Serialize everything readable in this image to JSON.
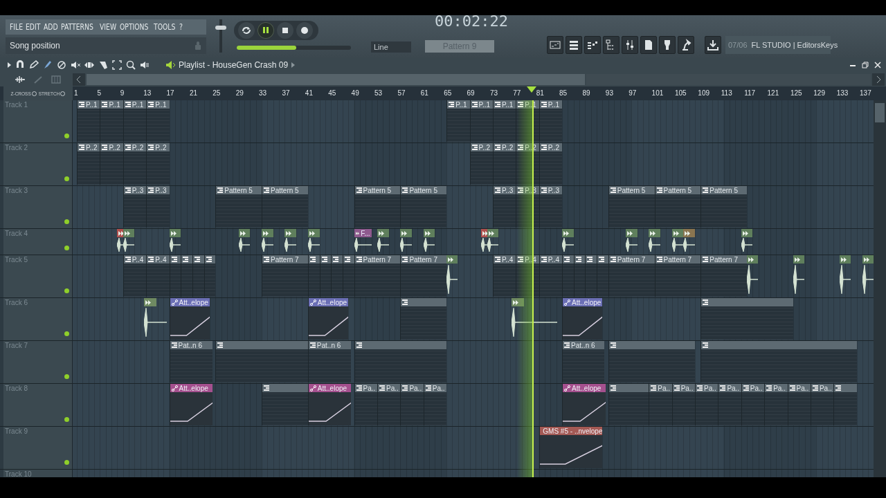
{
  "menu": [
    "FILE",
    "EDIT",
    "ADD",
    "PATTERNS",
    "VIEW",
    "OPTIONS",
    "TOOLS",
    "?"
  ],
  "song_position": {
    "placeholder": "Song position"
  },
  "sliders": [
    {
      "kind": "vertical",
      "level": 0.78
    },
    {
      "kind": "horizontal",
      "level": 0.52
    }
  ],
  "transport": {
    "time": "00:02:22",
    "buttons": [
      {
        "kind": "loop",
        "on": false
      },
      {
        "kind": "pause",
        "on": true
      },
      {
        "kind": "stop",
        "on": false
      },
      {
        "kind": "record",
        "on": false
      }
    ],
    "snap": "Line",
    "pattern": "Pattern 9"
  },
  "hint": {
    "counter": "07/06",
    "text": "FL STUDIO | EditorsKeys"
  },
  "playlist": {
    "title": "Playlist - HouseGen Crash 09",
    "toggles": [
      {
        "label": "Z-CROSS",
        "on": false
      },
      {
        "label": "STRETCH",
        "on": false
      }
    ],
    "ruler": [
      "1",
      "5",
      "9",
      "13",
      "17",
      "21",
      "25",
      "29",
      "33",
      "37",
      "41",
      "45",
      "49",
      "53",
      "57",
      "61",
      "65",
      "69",
      "73",
      "77",
      "81",
      "85",
      "89",
      "93",
      "97",
      "101",
      "105",
      "109",
      "113",
      "117",
      "121",
      "125",
      "129",
      "133",
      "137"
    ],
    "tracks": [
      {
        "name": "Track 1",
        "muted": false,
        "clips": [
          {
            "kind": "pattern",
            "label": "P..1"
          },
          {
            "kind": "pattern",
            "label": "P..1"
          },
          {
            "kind": "pattern",
            "label": "P..1"
          },
          {
            "kind": "pattern",
            "label": "P..1"
          },
          {
            "kind": "pattern",
            "label": "P..1"
          },
          {
            "kind": "pattern",
            "label": "P..1"
          },
          {
            "kind": "pattern",
            "label": "P..1"
          },
          {
            "kind": "pattern",
            "label": "P..1"
          },
          {
            "kind": "pattern",
            "label": "P..1"
          }
        ]
      },
      {
        "name": "Track 2",
        "muted": false,
        "clips": [
          {
            "kind": "pattern",
            "label": "P..2"
          },
          {
            "kind": "pattern",
            "label": "P..2"
          },
          {
            "kind": "pattern",
            "label": "P..2"
          },
          {
            "kind": "pattern",
            "label": "P..2"
          },
          {
            "kind": "pattern",
            "label": "P..2"
          },
          {
            "kind": "pattern",
            "label": "P..2"
          },
          {
            "kind": "pattern",
            "label": "P..2"
          },
          {
            "kind": "pattern",
            "label": "P..2"
          }
        ]
      },
      {
        "name": "Track 3",
        "muted": false,
        "clips": [
          {
            "kind": "pattern",
            "label": "P..3"
          },
          {
            "kind": "pattern",
            "label": "P..3"
          },
          {
            "kind": "pattern",
            "label": "Pattern 5"
          },
          {
            "kind": "pattern",
            "label": "Pattern 5"
          },
          {
            "kind": "pattern",
            "label": "Pattern 5"
          },
          {
            "kind": "pattern",
            "label": "Pattern 5"
          },
          {
            "kind": "pattern",
            "label": "P..3"
          },
          {
            "kind": "pattern",
            "label": "P..3"
          },
          {
            "kind": "pattern",
            "label": "P..3"
          },
          {
            "kind": "pattern",
            "label": "Pattern 5"
          },
          {
            "kind": "pattern",
            "label": "Pattern 5"
          },
          {
            "kind": "pattern",
            "label": "Pattern 5"
          }
        ]
      },
      {
        "name": "Track 4",
        "muted": false,
        "clips": [
          {
            "kind": "audio",
            "color": "#b0504e"
          },
          {
            "kind": "audio",
            "color": "#5f7f5c"
          },
          {
            "kind": "audio",
            "color": "#5f7f5c"
          },
          {
            "kind": "audio",
            "color": "#5f7f5c"
          },
          {
            "kind": "audio",
            "color": "#5f7f5c"
          },
          {
            "kind": "audio",
            "color": "#5f7f5c"
          },
          {
            "kind": "audio",
            "color": "#5f7f5c"
          },
          {
            "kind": "audio",
            "label": "F...",
            "color": "#8e5a8e"
          },
          {
            "kind": "audio",
            "color": "#5f7f5c"
          },
          {
            "kind": "audio",
            "color": "#5f7f5c"
          },
          {
            "kind": "audio",
            "color": "#5f7f5c"
          },
          {
            "kind": "audio",
            "color": "#b0504e"
          },
          {
            "kind": "audio",
            "color": "#5f7f5c"
          },
          {
            "kind": "audio",
            "color": "#5f7f5c"
          },
          {
            "kind": "audio",
            "color": "#5f7f5c"
          },
          {
            "kind": "audio",
            "color": "#5f7f5c"
          },
          {
            "kind": "audio",
            "color": "#5f7f5c"
          },
          {
            "kind": "audio",
            "color": "#8a7550"
          },
          {
            "kind": "audio",
            "color": "#5f7f5c"
          }
        ]
      },
      {
        "name": "Track 5",
        "muted": false,
        "clips": [
          {
            "kind": "pattern",
            "label": "P..4"
          },
          {
            "kind": "pattern",
            "label": "P..4"
          },
          {
            "kind": "pattern"
          },
          {
            "kind": "pattern"
          },
          {
            "kind": "pattern"
          },
          {
            "kind": "pattern"
          },
          {
            "kind": "pattern",
            "label": "Pattern 7"
          },
          {
            "kind": "pattern"
          },
          {
            "kind": "pattern"
          },
          {
            "kind": "pattern"
          },
          {
            "kind": "pattern"
          },
          {
            "kind": "pattern",
            "label": "Pattern 7"
          },
          {
            "kind": "pattern",
            "label": "Pattern 7"
          },
          {
            "kind": "audio",
            "color": "#5f7f5c"
          },
          {
            "kind": "pattern",
            "label": "P..4"
          },
          {
            "kind": "pattern",
            "label": "P..4"
          },
          {
            "kind": "pattern",
            "label": "P..4"
          },
          {
            "kind": "pattern"
          },
          {
            "kind": "pattern"
          },
          {
            "kind": "pattern"
          },
          {
            "kind": "pattern"
          },
          {
            "kind": "pattern",
            "label": "Pattern 7"
          },
          {
            "kind": "pattern",
            "label": "Pattern 7"
          },
          {
            "kind": "pattern",
            "label": "Pattern 7"
          },
          {
            "kind": "audio",
            "color": "#5f7f5c"
          },
          {
            "kind": "audio",
            "color": "#5f7f5c"
          },
          {
            "kind": "audio",
            "color": "#5f7f5c"
          },
          {
            "kind": "audio",
            "color": "#5f7f5c"
          }
        ]
      },
      {
        "name": "Track 6",
        "muted": false,
        "clips": [
          {
            "kind": "audio",
            "color": "#6f8a62"
          },
          {
            "kind": "automation",
            "label": "Att..elope",
            "color": "#6b6fb5"
          },
          {
            "kind": "automation",
            "label": "Att..elope",
            "color": "#6b6fb5"
          },
          {
            "kind": "pattern"
          },
          {
            "kind": "audio",
            "color": "#6f8a62"
          },
          {
            "kind": "automation",
            "label": "Att..elope",
            "color": "#6b6fb5"
          },
          {
            "kind": "pattern"
          }
        ]
      },
      {
        "name": "Track 7",
        "muted": false,
        "clips": [
          {
            "kind": "pattern",
            "label": "Pat..n 6"
          },
          {
            "kind": "pattern"
          },
          {
            "kind": "pattern",
            "label": "Pat..n 6"
          },
          {
            "kind": "pattern"
          },
          {
            "kind": "pattern",
            "label": "Pat..n 6"
          },
          {
            "kind": "pattern"
          },
          {
            "kind": "pattern"
          }
        ]
      },
      {
        "name": "Track 8",
        "muted": false,
        "clips": [
          {
            "kind": "automation",
            "label": "Att..elope",
            "color": "#a4508e"
          },
          {
            "kind": "pattern"
          },
          {
            "kind": "automation",
            "label": "Att..elope",
            "color": "#a4508e"
          },
          {
            "kind": "pattern",
            "label": "Pa.."
          },
          {
            "kind": "pattern",
            "label": "Pa.."
          },
          {
            "kind": "pattern",
            "label": "Pa.."
          },
          {
            "kind": "pattern",
            "label": "Pa.."
          },
          {
            "kind": "automation",
            "label": "Att..elope",
            "color": "#a4508e"
          },
          {
            "kind": "pattern"
          },
          {
            "kind": "pattern",
            "label": "Pa.."
          },
          {
            "kind": "pattern",
            "label": "Pa.."
          },
          {
            "kind": "pattern",
            "label": "Pa.."
          },
          {
            "kind": "pattern",
            "label": "Pa.."
          },
          {
            "kind": "pattern",
            "label": "Pa.."
          },
          {
            "kind": "pattern",
            "label": "Pa.."
          },
          {
            "kind": "pattern",
            "label": "Pa.."
          },
          {
            "kind": "pattern",
            "label": "Pa.."
          },
          {
            "kind": "pattern"
          }
        ]
      },
      {
        "name": "Track 9",
        "muted": false,
        "clips": [
          {
            "kind": "automation",
            "label": "GMS #5 - ..nvelope",
            "color": "#a45a55"
          }
        ]
      },
      {
        "name": "Track 10"
      }
    ]
  }
}
